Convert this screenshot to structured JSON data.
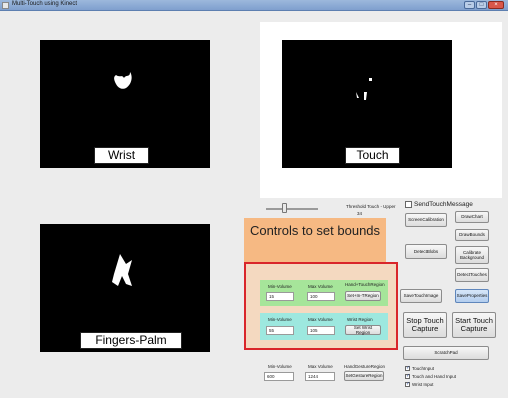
{
  "window": {
    "title": "Multi-Touch using Kinect",
    "controls": [
      "–",
      "□",
      "×"
    ]
  },
  "panels": {
    "wrist_caption": "Wrist",
    "touch_caption": "Touch",
    "fingers_caption": "Fingers-Palm"
  },
  "threshold": {
    "label": "Threshold Touch - Upper",
    "value": "34",
    "fill_fraction": 0.3
  },
  "send_touch_message": {
    "label": "SendTouchMessage",
    "checked": false
  },
  "buttons": {
    "screen_calibration": "ScreenCalibration",
    "draw_chart": "DrawChart",
    "draw_bounds": "DrawBounds",
    "detect_blobs": "DetectBlobs",
    "calibrate_background": "Calibrate Background",
    "detect_touches": "DetectTouches",
    "save_touch_image": "SaveTouchImage",
    "save_properties": "SaveProperties",
    "stop_touch_capture": "Stop Touch Capture",
    "start_touch_capture": "Start Touch Capture",
    "scratch_pad": "ScratchPad"
  },
  "overlay": {
    "title": "Controls to set bounds"
  },
  "hand_touch_region": {
    "min_label": "Min-Volume",
    "max_label": "Max Volume",
    "region_label": "Hand+TouchRegion",
    "min_value": "15",
    "max_value": "100",
    "button": "Set+In-TRegion"
  },
  "wrist_region": {
    "min_label": "Min-Volume",
    "max_label": "Max Volume",
    "region_label": "Wrist Region",
    "min_value": "55",
    "max_value": "105",
    "button": "Set Wrist Region"
  },
  "hand_gesture_region": {
    "min_label": "Min-Volume",
    "max_label": "Max Volume",
    "region_label": "HandGestureRegion",
    "min_value": "600",
    "max_value": "1244",
    "button": "SetGestureRegion"
  },
  "checkboxes": [
    {
      "label": "TouchInput",
      "checked": true
    },
    {
      "label": "Touch and Hand Input",
      "checked": true
    },
    {
      "label": "Wrist Input",
      "checked": true
    }
  ]
}
